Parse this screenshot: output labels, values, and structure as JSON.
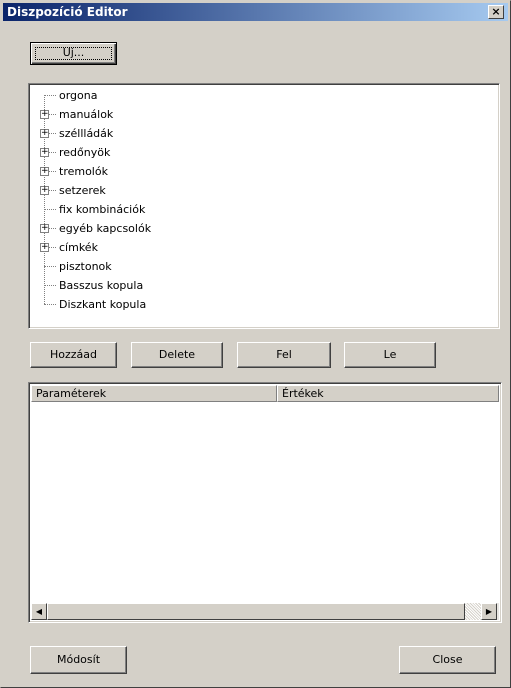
{
  "window": {
    "title": "Diszpozíció Editor",
    "close_label": "×"
  },
  "new_button": {
    "label": "Uj..."
  },
  "tree": {
    "items": [
      {
        "label": "orgona",
        "expandable": false
      },
      {
        "label": "manuálok",
        "expandable": true
      },
      {
        "label": "széllládák",
        "expandable": true
      },
      {
        "label": "redőnyök",
        "expandable": true
      },
      {
        "label": "tremolók",
        "expandable": true
      },
      {
        "label": "setzerek",
        "expandable": true
      },
      {
        "label": "fix kombinációk",
        "expandable": false
      },
      {
        "label": "egyéb kapcsolók",
        "expandable": true
      },
      {
        "label": "címkék",
        "expandable": true
      },
      {
        "label": "pisztonok",
        "expandable": false
      },
      {
        "label": "Basszus kopula",
        "expandable": false
      },
      {
        "label": "Diszkant kopula",
        "expandable": false
      }
    ]
  },
  "actions": {
    "add": "Hozzáad",
    "delete": "Delete",
    "up": "Fel",
    "down": "Le"
  },
  "table": {
    "col_params": "Paraméterek",
    "col_values": "Értékek"
  },
  "footer": {
    "modify": "Módosít",
    "close": "Close"
  }
}
